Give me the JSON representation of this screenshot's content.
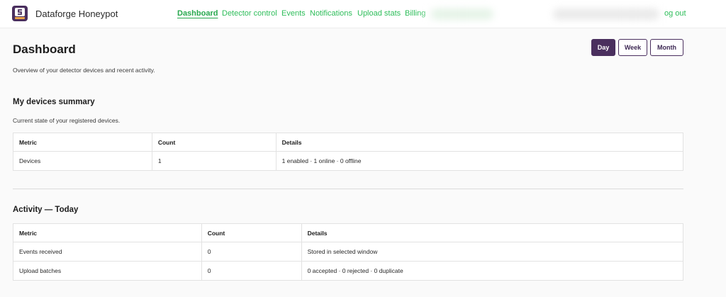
{
  "header": {
    "brand": "Dataforge Honeypot",
    "nav": [
      {
        "label": "Dashboard",
        "active": true
      },
      {
        "label": "Detector control"
      },
      {
        "label": "Events"
      },
      {
        "label": "Notifications"
      },
      {
        "label": "Upload stats"
      },
      {
        "label": "Billing"
      }
    ],
    "logout_label": "og out"
  },
  "page": {
    "title": "Dashboard",
    "subtitle": "Overview of your detector devices and recent activity.",
    "range_buttons": [
      {
        "label": "Day",
        "active": true
      },
      {
        "label": "Week"
      },
      {
        "label": "Month"
      }
    ]
  },
  "devices_summary": {
    "title": "My devices summary",
    "description": "Current state of your registered devices.",
    "columns": [
      "Metric",
      "Count",
      "Details"
    ],
    "rows": [
      {
        "metric": "Devices",
        "count": "1",
        "details": "1 enabled · 1 online · 0 offline"
      }
    ]
  },
  "activity": {
    "title": "Activity — Today",
    "columns": [
      "Metric",
      "Count",
      "Details"
    ],
    "rows": [
      {
        "metric": "Events received",
        "count": "0",
        "details": "Stored in selected window"
      },
      {
        "metric": "Upload batches",
        "count": "0",
        "details": "0 accepted · 0 rejected · 0 duplicate"
      }
    ]
  },
  "colors": {
    "brand_purple": "#4a2f5e",
    "nav_green": "#2ebd5a",
    "background": "#fafafa"
  },
  "icons": {
    "logo": "dataforge-logo-icon"
  }
}
